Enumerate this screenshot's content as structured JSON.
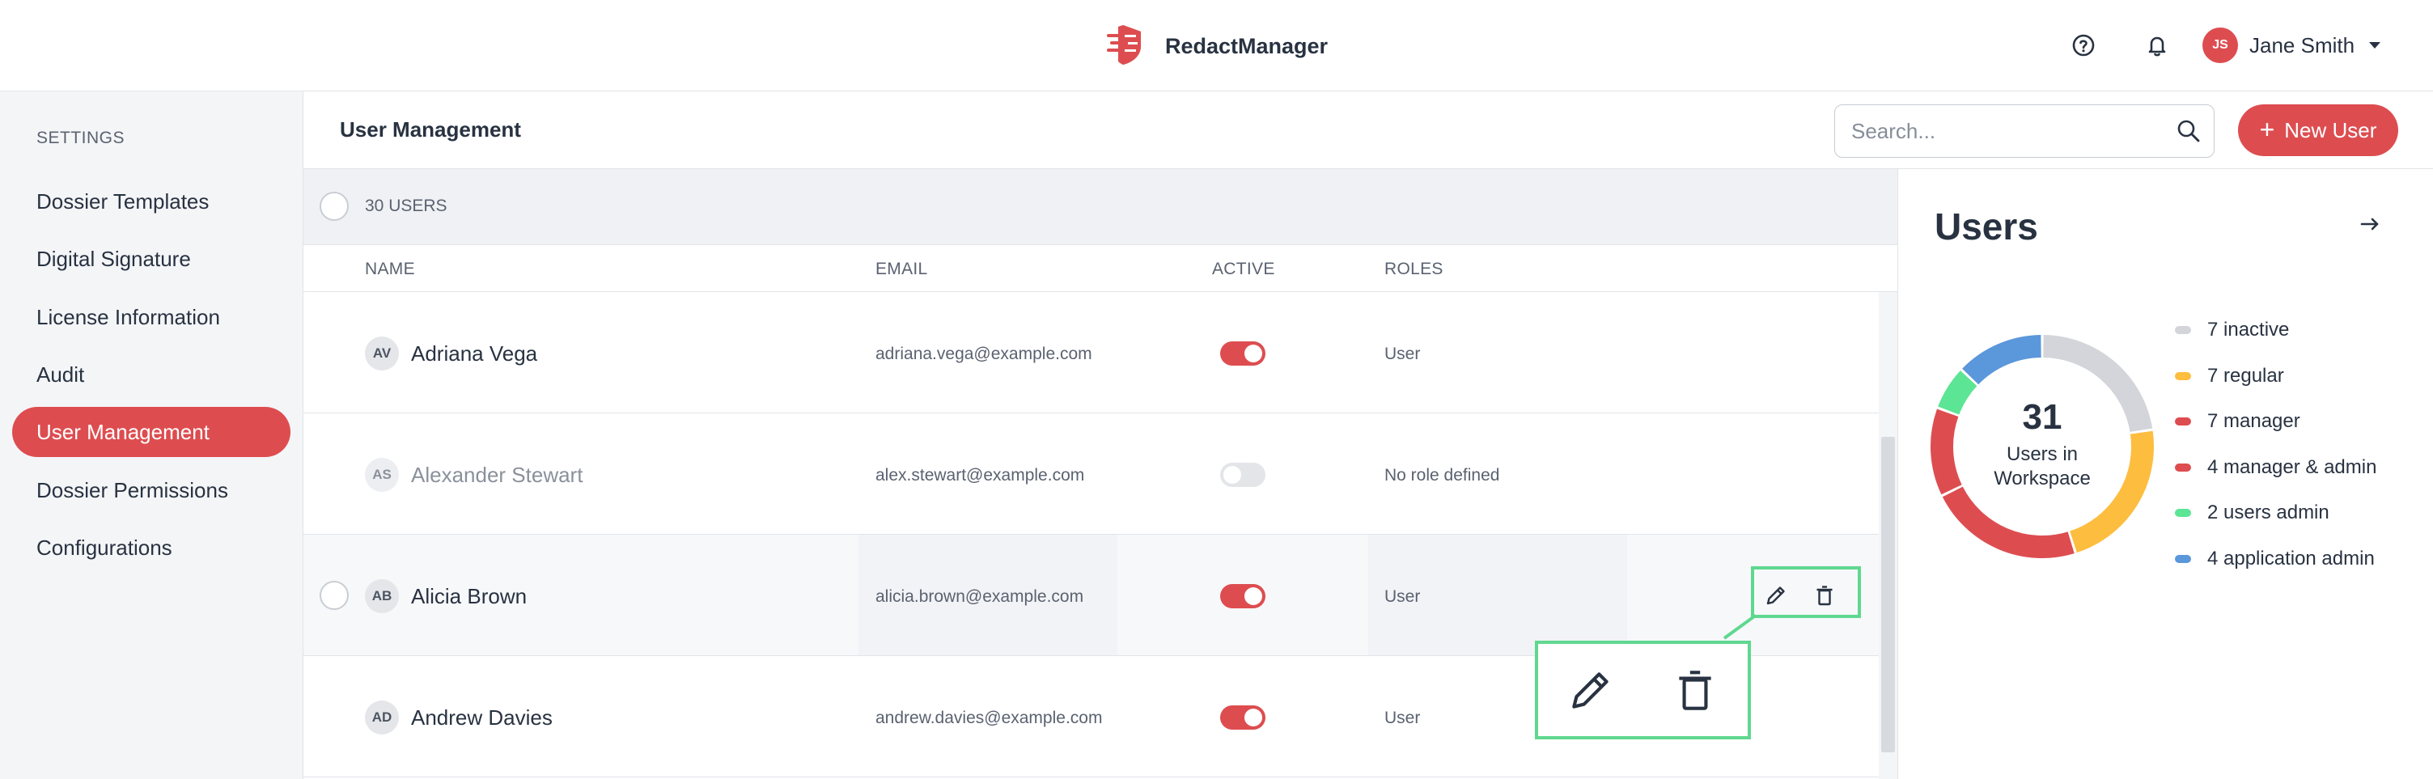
{
  "app": {
    "brand": "RedactManager",
    "brand_color": "#dd4d50"
  },
  "topbar": {
    "help_icon": "help-circle-icon",
    "notifications_icon": "bell-icon",
    "user": {
      "initials": "JS",
      "name": "Jane Smith"
    }
  },
  "sidebar": {
    "heading": "SETTINGS",
    "items": [
      {
        "label": "Dossier Templates",
        "active": false
      },
      {
        "label": "Digital Signature",
        "active": false
      },
      {
        "label": "License Information",
        "active": false
      },
      {
        "label": "Audit",
        "active": false
      },
      {
        "label": "User Management",
        "active": true
      },
      {
        "label": "Dossier Permissions",
        "active": false
      },
      {
        "label": "Configurations",
        "active": false
      }
    ]
  },
  "header": {
    "title": "User Management",
    "search_placeholder": "Search...",
    "search_value": "",
    "new_user_label": "New User"
  },
  "table": {
    "count_label": "30 USERS",
    "columns": [
      "NAME",
      "EMAIL",
      "ACTIVE",
      "ROLES"
    ],
    "rows": [
      {
        "initials": "AV",
        "name": "Adriana Vega",
        "email": "adriana.vega@example.com",
        "active": true,
        "role": "User"
      },
      {
        "initials": "AS",
        "name": "Alexander Stewart",
        "email": "alex.stewart@example.com",
        "active": false,
        "role": "No role defined"
      },
      {
        "initials": "AB",
        "name": "Alicia Brown",
        "email": "alicia.brown@example.com",
        "active": true,
        "role": "User"
      },
      {
        "initials": "AD",
        "name": "Andrew Davies",
        "email": "andrew.davies@example.com",
        "active": true,
        "role": "User"
      }
    ],
    "row_actions": {
      "edit_icon": "pencil-icon",
      "delete_icon": "trash-icon"
    }
  },
  "stats": {
    "title": "Users",
    "total": "31",
    "total_label_line1": "Users in",
    "total_label_line2": "Workspace",
    "segments": [
      {
        "label": "7 inactive",
        "value": 7,
        "color": "#d3d5da"
      },
      {
        "label": "7 regular",
        "value": 7,
        "color": "#fdbd3f"
      },
      {
        "label": "7 manager",
        "value": 7,
        "color": "#dd4d50"
      },
      {
        "label": "4 manager & admin",
        "value": 4,
        "color": "#dd4d50"
      },
      {
        "label": "2 users admin",
        "value": 2,
        "color": "#5ce594"
      },
      {
        "label": "4 application admin",
        "value": 4,
        "color": "#5b97db"
      }
    ]
  }
}
